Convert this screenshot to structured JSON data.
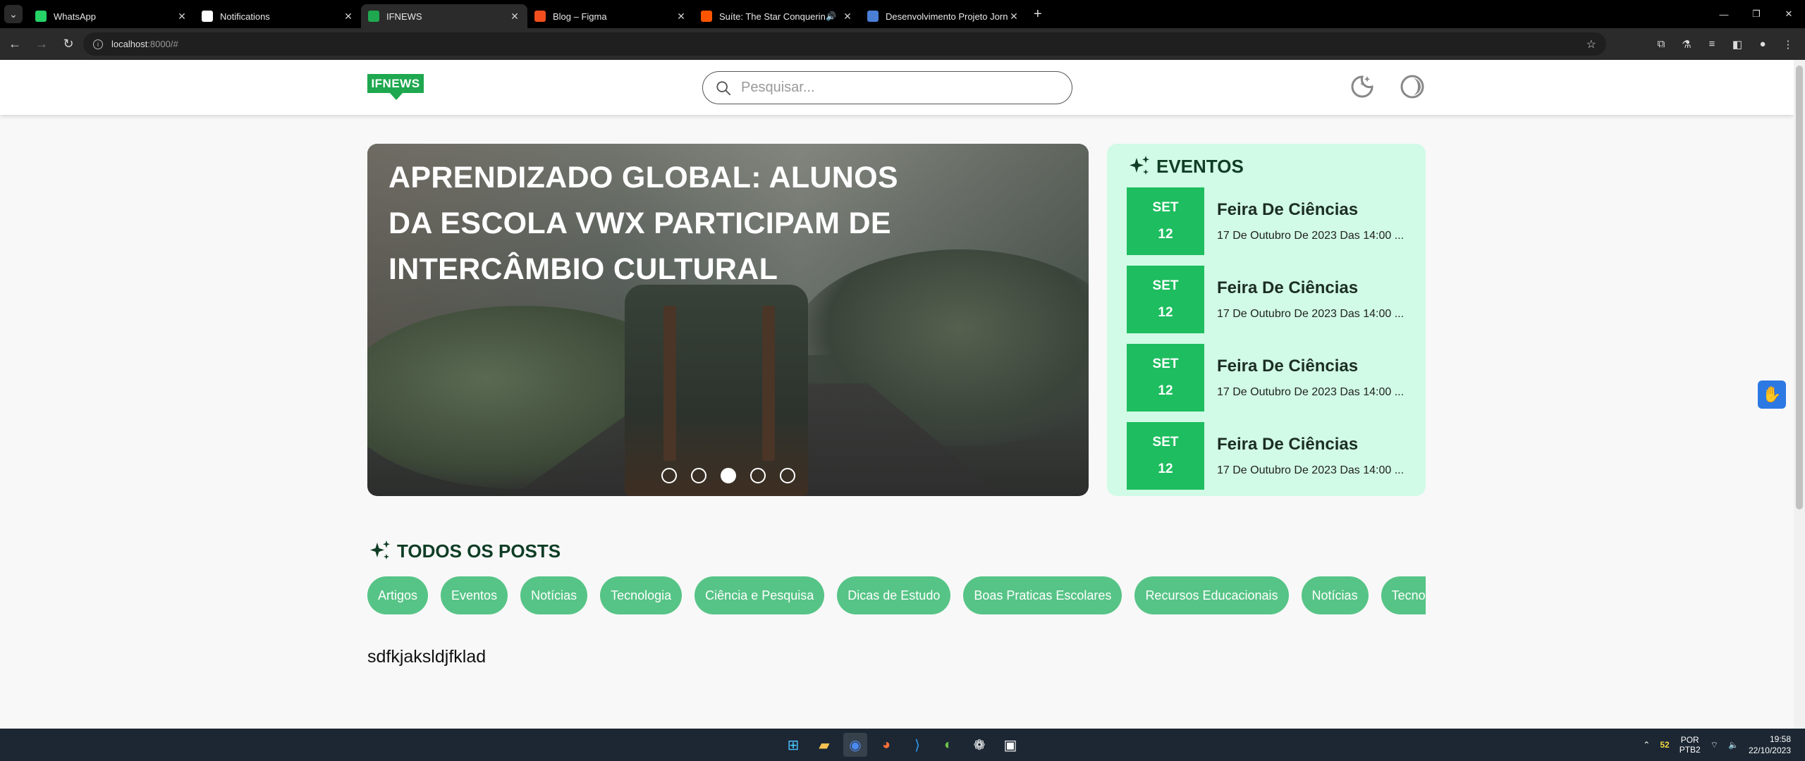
{
  "browser": {
    "tabs": [
      {
        "title": "WhatsApp",
        "icon": "whatsapp-icon",
        "color": "#25d366"
      },
      {
        "title": "Notifications",
        "icon": "github-icon",
        "color": "#ffffff"
      },
      {
        "title": "IFNEWS",
        "icon": "ifnews-icon",
        "color": "#1fa84f",
        "active": true
      },
      {
        "title": "Blog – Figma",
        "icon": "figma-icon",
        "color": "#f24e1e"
      },
      {
        "title": "Suíte: The Star Conquering",
        "icon": "soundcloud-icon",
        "color": "#ff5500"
      },
      {
        "title": "Desenvolvimento Projeto Jorn",
        "icon": "doc-icon",
        "color": "#4a7fd6"
      }
    ],
    "url_host": "localhost",
    "url_rest": ":8000/#"
  },
  "header": {
    "logo": "IFNEWS",
    "search_placeholder": "Pesquisar..."
  },
  "hero": {
    "title": "Aprendizado Global: Alunos da Escola VWX Participam de Intercâmbio Cultural",
    "slide_count": 5,
    "active_slide": 3
  },
  "events": {
    "title": "EVENTOS",
    "items": [
      {
        "month": "SET",
        "day": "12",
        "name": "Feira De Ciências",
        "when": "17 De Outubro De 2023 Das 14:00 ..."
      },
      {
        "month": "SET",
        "day": "12",
        "name": "Feira De Ciências",
        "when": "17 De Outubro De 2023 Das 14:00 ..."
      },
      {
        "month": "SET",
        "day": "12",
        "name": "Feira De Ciências",
        "when": "17 De Outubro De 2023 Das 14:00 ..."
      },
      {
        "month": "SET",
        "day": "12",
        "name": "Feira De Ciências",
        "when": "17 De Outubro De 2023 Das 14:00 ..."
      }
    ]
  },
  "posts": {
    "title": "TODOS OS POSTS",
    "categories": [
      "Artigos",
      "Eventos",
      "Notícias",
      "Tecnologia",
      "Ciência e Pesquisa",
      "Dicas de Estudo",
      "Boas Praticas Escolares",
      "Recursos Educacionais",
      "Notícias",
      "Tecnologia"
    ],
    "content": "sdfkjaksldjfklad"
  },
  "taskbar": {
    "tray_value": "52",
    "lang": "POR",
    "layout": "PTB2",
    "time": "19:58",
    "date": "22/10/2023"
  }
}
